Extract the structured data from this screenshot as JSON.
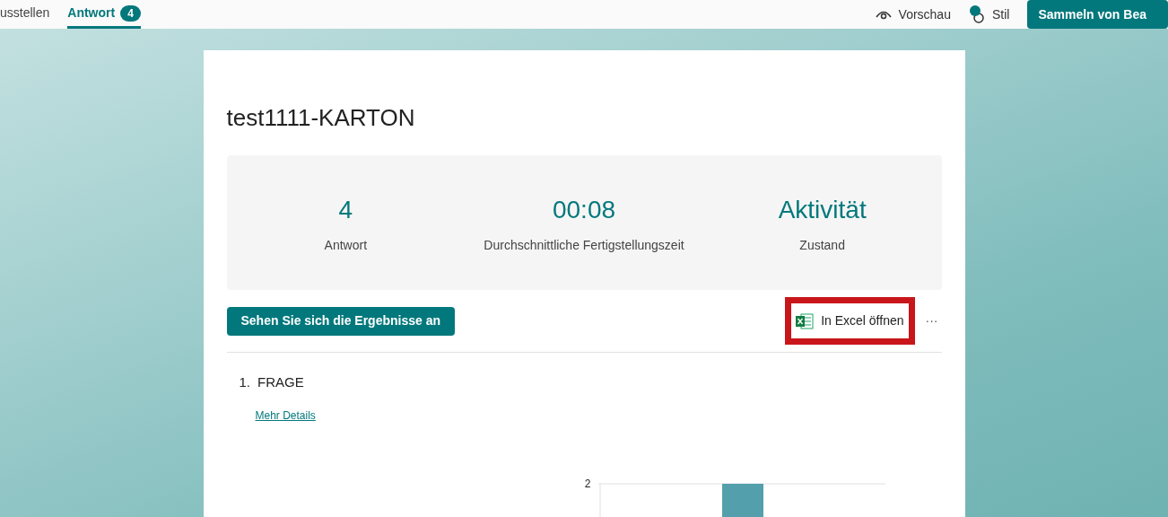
{
  "tabs": [
    {
      "label": "usstellen",
      "selected": false
    },
    {
      "label": "Antwort",
      "badge": "4",
      "selected": true
    }
  ],
  "header_actions": [
    {
      "kind": "preview",
      "label": "Vorschau"
    },
    {
      "kind": "style",
      "label": "Stil"
    }
  ],
  "primary_button": "Sammeln von Bea",
  "form": {
    "title": "test1111-KARTON",
    "stats": [
      {
        "value": "4",
        "label": "Antwort"
      },
      {
        "value": "00:08",
        "label": "Durchschnittliche Fertigstellungszeit"
      },
      {
        "value": "Aktivität",
        "label": "Zustand"
      }
    ],
    "results_button": "Sehen Sie sich die Ergebnisse an",
    "excel": {
      "label": "In Excel öffnen",
      "highlighted": true
    },
    "more": "···",
    "question": {
      "number": "1.",
      "title": "FRAGE",
      "link": "Mehr Details",
      "axis_tick": "2"
    }
  }
}
